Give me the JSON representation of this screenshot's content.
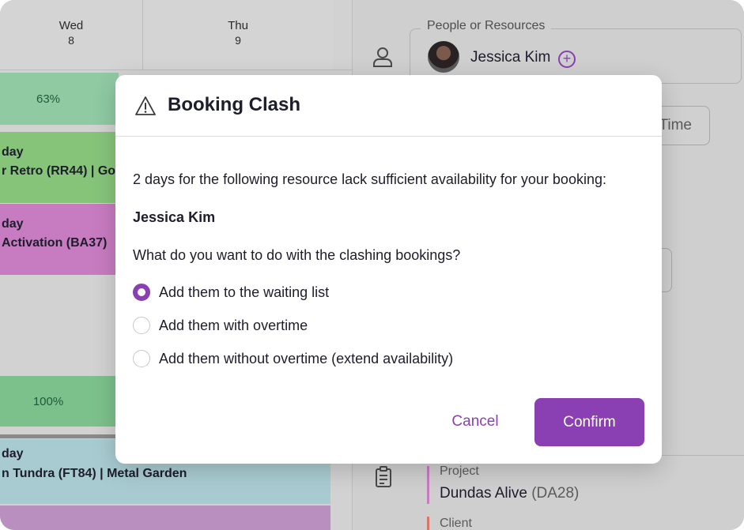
{
  "calendar": {
    "days": [
      {
        "name": "Wed",
        "num": "8"
      },
      {
        "name": "Thu",
        "num": "9"
      }
    ],
    "bookings": [
      {
        "pct": "63%",
        "color": "#8fcaa3"
      },
      {
        "line1": "day",
        "line2": "r Retro (RR44) | Go",
        "color": "#86c47a"
      },
      {
        "line1": "day",
        "line2": "Activation (BA37)",
        "color": "#c77bc0"
      },
      {
        "pct": "100%",
        "color": "#7cc08b"
      },
      {
        "line1": "day",
        "line2": "n Tundra (FT84) | Metal Garden",
        "color": "#a8cbd1"
      }
    ]
  },
  "panel": {
    "people_legend": "People or Resources",
    "person_name": "Jessica Kim",
    "add_symbol": "+",
    "time_button": "Time",
    "project_label": "Project",
    "project_name": "Dundas Alive",
    "project_code": "(DA28)",
    "client_label": "Client",
    "project_color": "#c77bc0",
    "client_color": "#d9776a"
  },
  "modal": {
    "title": "Booking Clash",
    "message": "2 days for the following resource lack sufficient availability for your booking:",
    "resource": "Jessica Kim",
    "question": "What do you want to do with the clashing bookings?",
    "options": [
      {
        "label": "Add them to the waiting list",
        "checked": true
      },
      {
        "label": "Add them with overtime",
        "checked": false
      },
      {
        "label": "Add them without overtime (extend availability)",
        "checked": false
      }
    ],
    "cancel_label": "Cancel",
    "confirm_label": "Confirm",
    "accent": "#8a3fb2",
    "icons": {
      "warning": "warning-icon",
      "person": "person-icon",
      "clipboard": "clipboard-icon"
    }
  }
}
